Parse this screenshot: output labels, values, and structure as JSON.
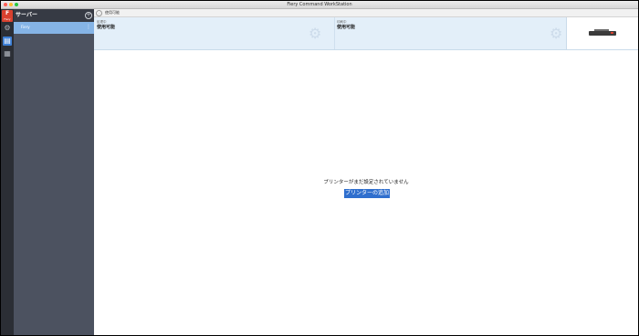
{
  "window": {
    "title": "Fiery Command WorkStation"
  },
  "rail": {
    "logo_text": "Fiery",
    "icons": [
      "settings-icon",
      "job-center-icon",
      "apps-grid-icon"
    ]
  },
  "server_panel": {
    "title": "サーバー",
    "add_icon": "plus-icon",
    "selected_server": "Fiery",
    "more_icon": "more-vertical-icon"
  },
  "tabbar": {
    "label": "使用可能"
  },
  "status": {
    "processing_label": "処理中",
    "processing_value": "使用可能",
    "printing_label": "印刷中",
    "printing_value": "使用可能"
  },
  "main": {
    "empty_message": "プリンターがまだ設定されていません",
    "add_printer_label": "プリンターの追加"
  },
  "colors": {
    "accent": "#3d7fd6",
    "brand": "#d8412f",
    "status_strip": "#e3eff9"
  }
}
